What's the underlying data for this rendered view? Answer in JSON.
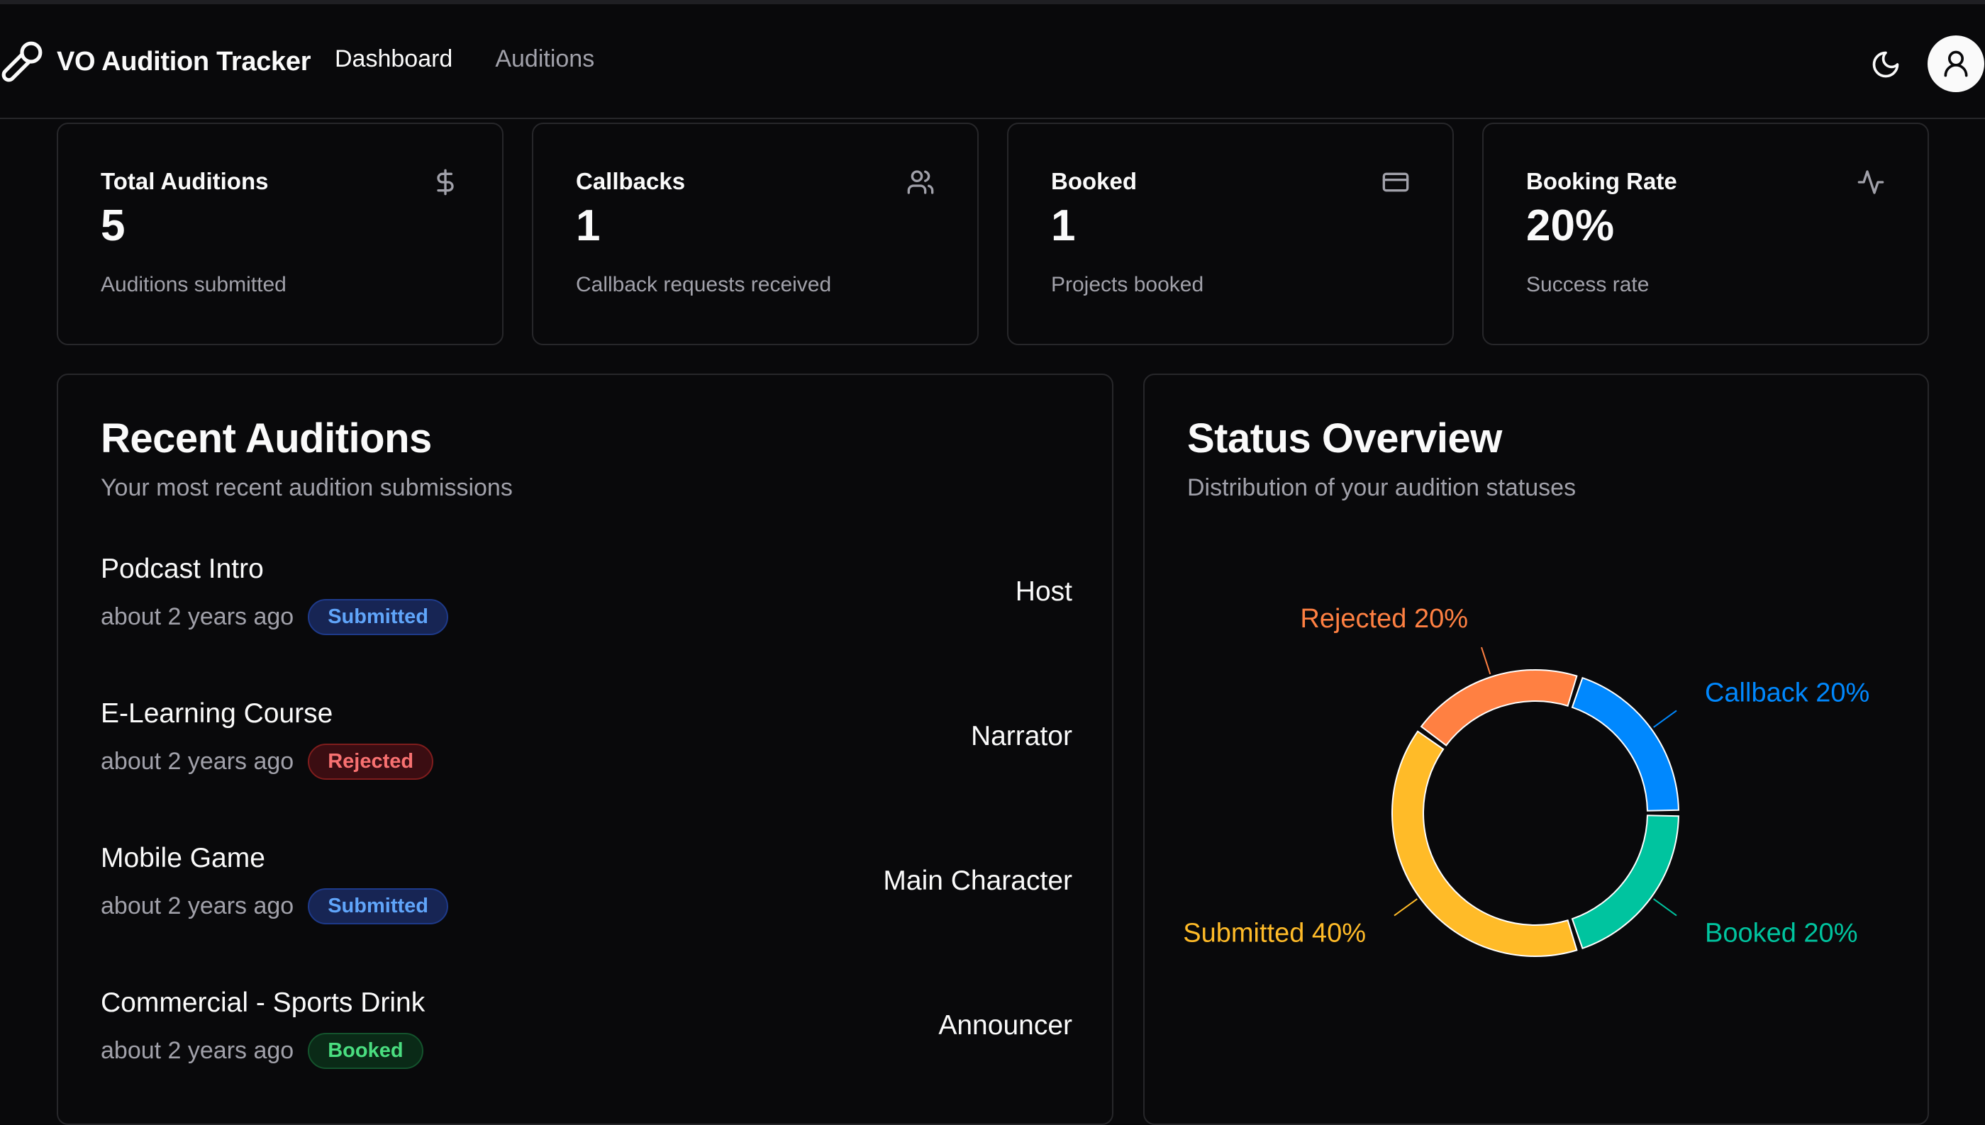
{
  "app": {
    "title": "VO Audition Tracker",
    "nav": [
      {
        "label": "Dashboard",
        "active": true
      },
      {
        "label": "Auditions",
        "active": false
      }
    ],
    "icons": {
      "brand": "microphone-icon",
      "theme": "moon-icon",
      "user": "user-icon"
    }
  },
  "stats": [
    {
      "label": "Total Auditions",
      "value": "5",
      "desc": "Auditions submitted",
      "icon": "dollar-icon"
    },
    {
      "label": "Callbacks",
      "value": "1",
      "desc": "Callback requests received",
      "icon": "users-icon"
    },
    {
      "label": "Booked",
      "value": "1",
      "desc": "Projects booked",
      "icon": "credit-card-icon"
    },
    {
      "label": "Booking Rate",
      "value": "20%",
      "desc": "Success rate",
      "icon": "activity-icon"
    }
  ],
  "recent": {
    "title": "Recent Auditions",
    "subtitle": "Your most recent audition submissions",
    "items": [
      {
        "title": "Podcast Intro",
        "time": "about 2 years ago",
        "status": "Submitted",
        "role": "Host"
      },
      {
        "title": "E-Learning Course",
        "time": "about 2 years ago",
        "status": "Rejected",
        "role": "Narrator"
      },
      {
        "title": "Mobile Game",
        "time": "about 2 years ago",
        "status": "Submitted",
        "role": "Main Character"
      },
      {
        "title": "Commercial - Sports Drink",
        "time": "about 2 years ago",
        "status": "Booked",
        "role": "Announcer"
      }
    ]
  },
  "overview": {
    "title": "Status Overview",
    "subtitle": "Distribution of your audition statuses"
  },
  "chart_data": {
    "type": "pie",
    "donut": true,
    "categories": [
      "Callback",
      "Rejected",
      "Submitted",
      "Booked"
    ],
    "values": [
      20,
      20,
      40,
      20
    ],
    "labels": [
      "Callback 20%",
      "Rejected 20%",
      "Submitted 40%",
      "Booked 20%"
    ],
    "colors": [
      "#0088fe",
      "#ff8042",
      "#ffbb28",
      "#00c49f"
    ]
  },
  "colors": {
    "background": "#09090b",
    "border": "#27272a",
    "muted_text": "#a1a1aa"
  }
}
